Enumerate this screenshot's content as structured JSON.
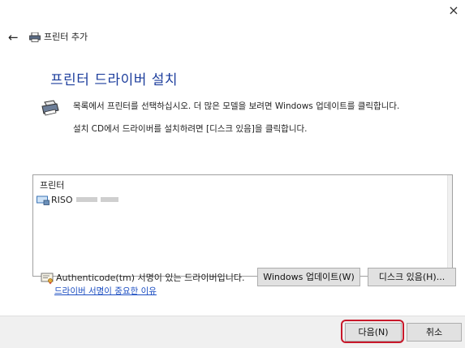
{
  "window": {
    "close_symbol": "×"
  },
  "header": {
    "back_symbol": "←",
    "title": "프린터 추가"
  },
  "main": {
    "heading": "프린터 드라이버 설치",
    "description_line1": "목록에서 프린터를 선택하십시오. 더 많은 모델을 보려면 Windows 업데이트를 클릭합니다.",
    "description_line2": "설치 CD에서 드라이버를 설치하려면 [디스크 있음]을 클릭합니다.",
    "printer_list": {
      "header": "프린터",
      "items": [
        {
          "label": "RISO"
        }
      ]
    },
    "signature_status": "Authenticode(tm) 서명이 있는 드라이버입니다.",
    "signature_link": "드라이버 서명이 중요한 이유",
    "windows_update_button": "Windows 업데이트(W)",
    "have_disk_button": "디스크 있음(H)..."
  },
  "footer": {
    "next_button": "다음(N)",
    "cancel_button": "취소"
  },
  "colors": {
    "heading": "#1c3d9c",
    "link": "#1c4ec2",
    "highlight": "#c8182a"
  }
}
